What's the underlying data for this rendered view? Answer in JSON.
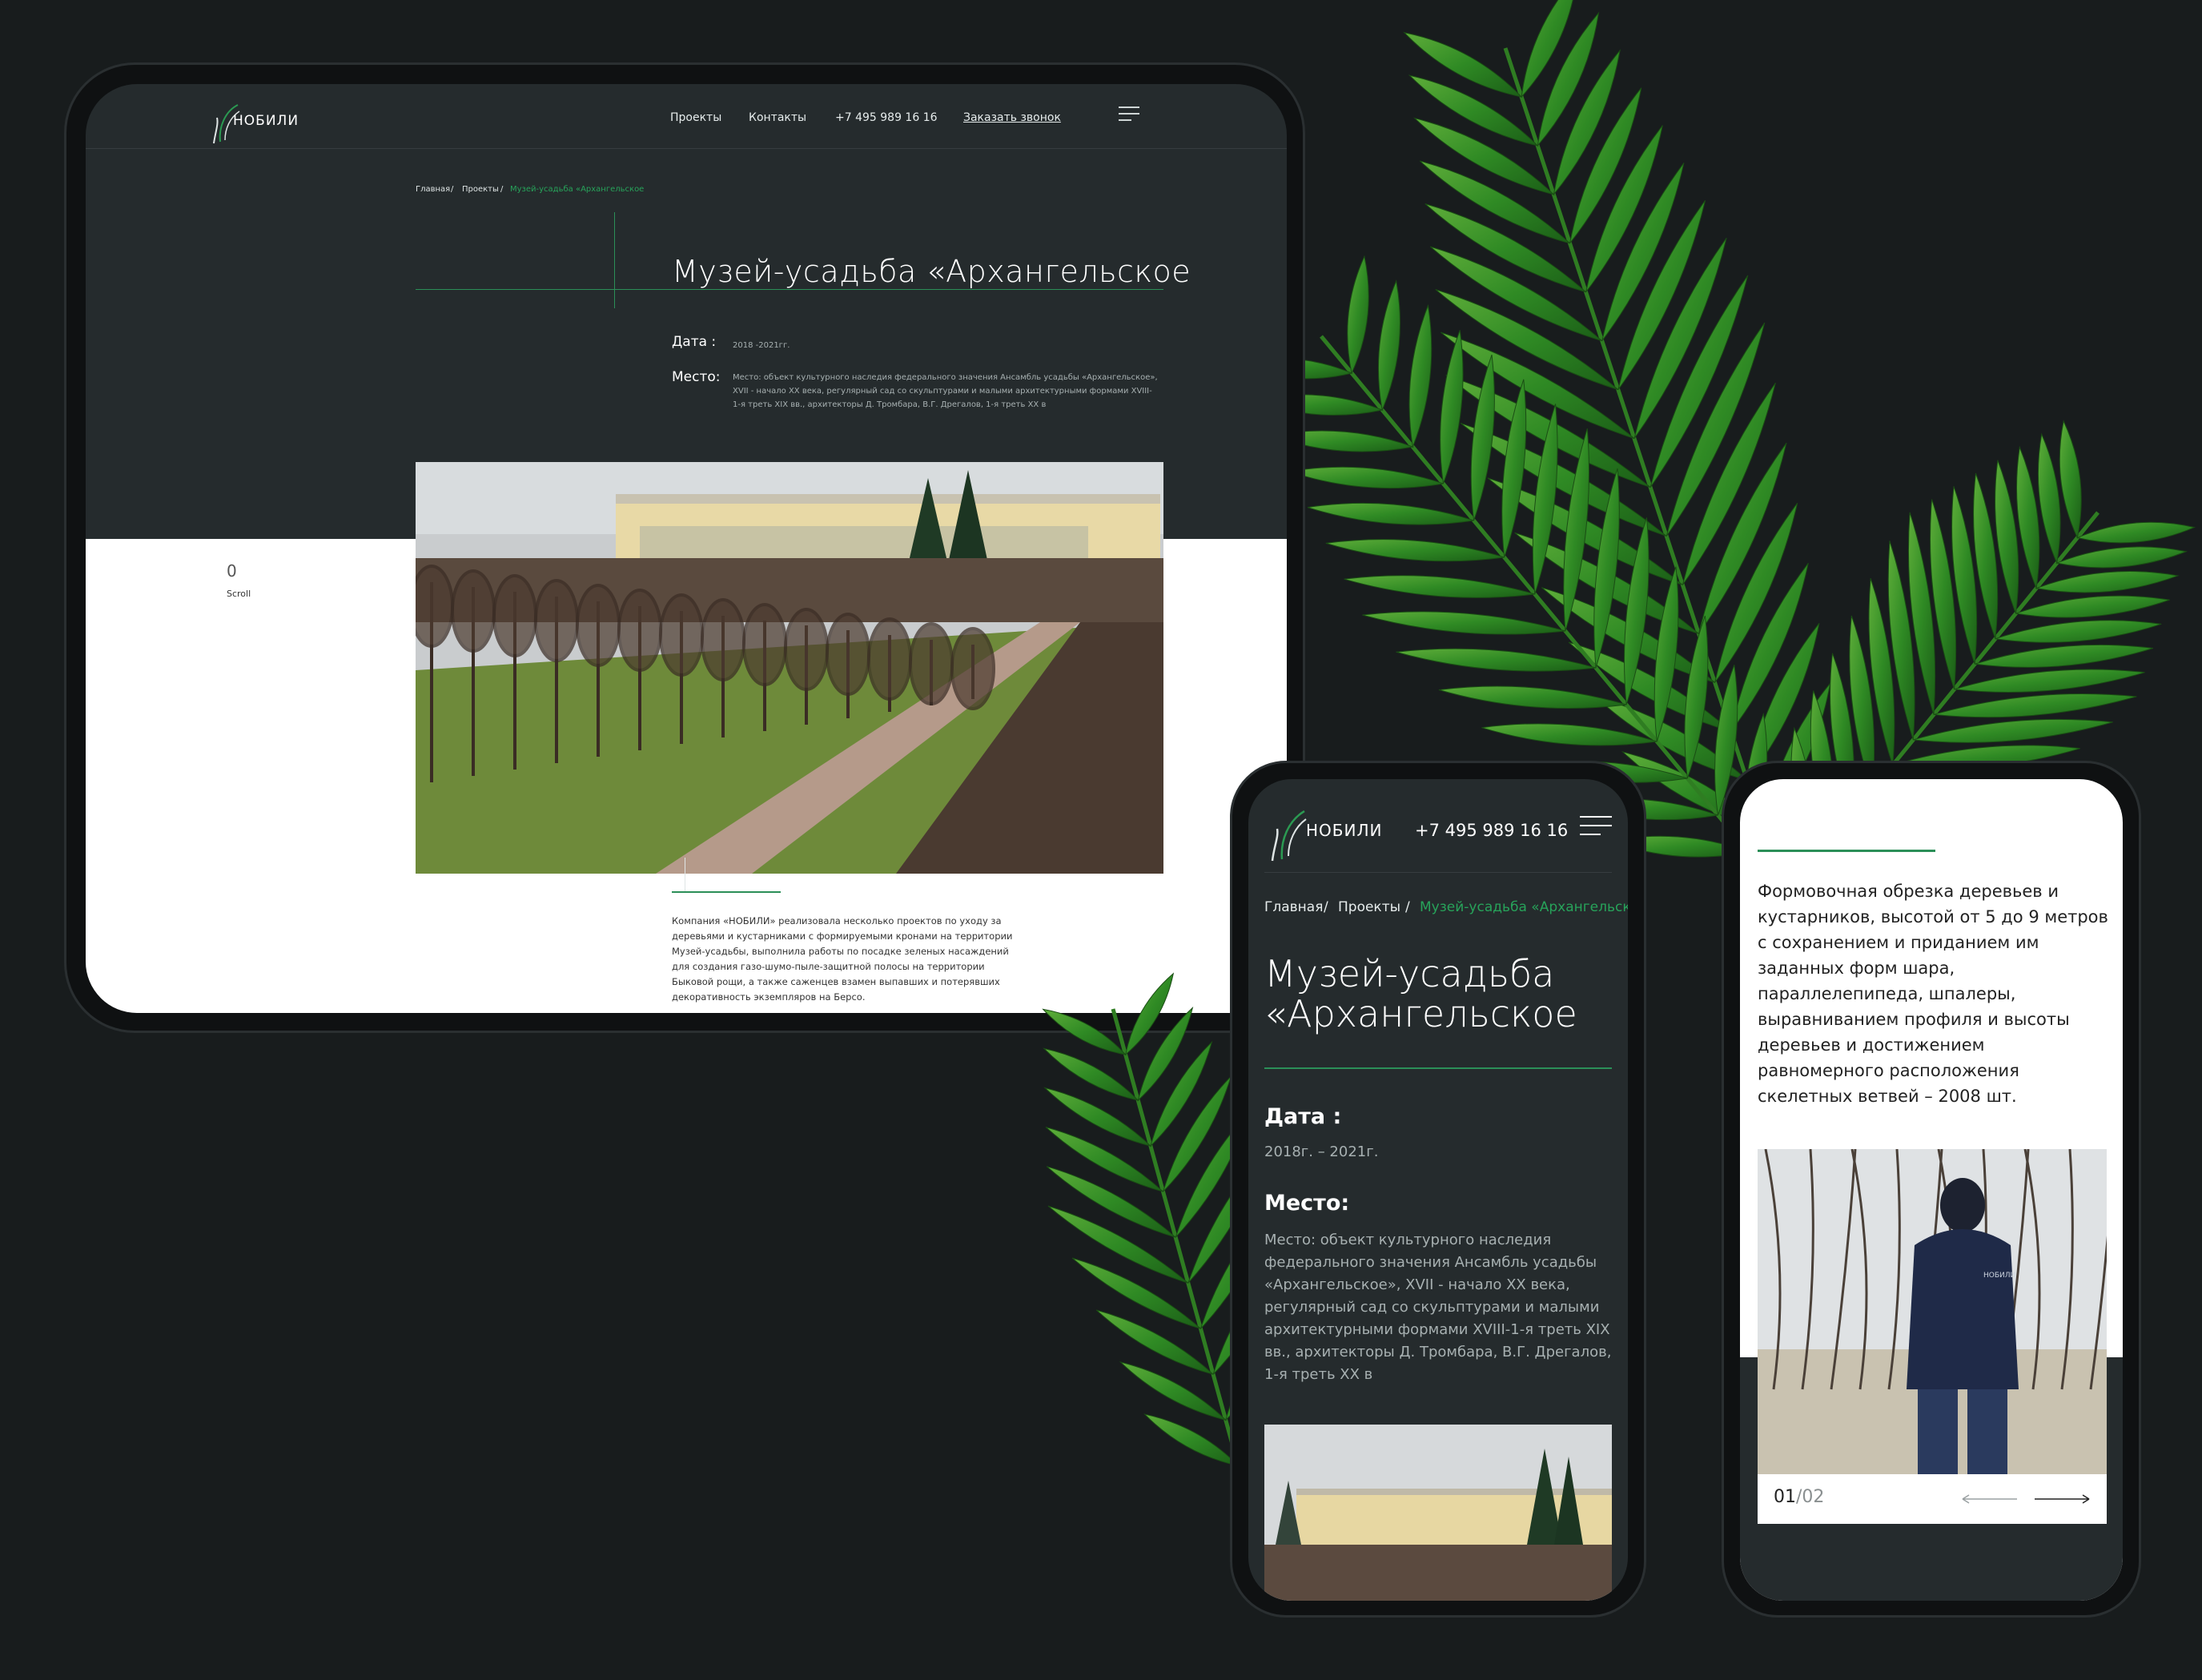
{
  "brand": {
    "logo_text": "НОБИЛИ"
  },
  "desktop": {
    "nav": {
      "projects": "Проекты",
      "contacts": "Контакты",
      "phone": "+7 495 989 16 16",
      "cta": "Заказать звонок"
    },
    "breadcrumb": {
      "home": "Главная",
      "sep1": "/",
      "projects": "Проекты",
      "sep2": "/",
      "current": "Музей-усадьба «Архангельское"
    },
    "title": "Музей-усадьба «Архангельское",
    "date_label": "Дата :",
    "date_value": "2018 -2021гг.",
    "place_label": "Место:",
    "place_value": "Место: объект культурного наследия федерального значения Ансамбль усадьбы «Архангельское», XVII - начало XX века, регулярный сад со скульптурами и малыми архитектурными формами XVIII-1-я треть XIX вв., архитекторы Д. Тромбара, В.Г. Дрегалов, 1-я треть XX в",
    "scroll_counter": "0",
    "scroll_label": "Scroll",
    "description": "Компания «НОБИЛИ» реализовала несколько проектов по уходу за деревьями и кустарниками с формируемыми кронами на территории Музей-усадьбы, выполнила работы по посадке зеленых насаждений для создания газо-шумо-пыле-защитной полосы на территории Быковой рощи, а также саженцев взамен выпавших и потерявших декоративность экземпляров на Берсо."
  },
  "mobile_left": {
    "phone": "+7 495 989 16 16",
    "breadcrumb": {
      "home": "Главная",
      "sep1": "/",
      "projects": "Проекты",
      "sep2": "/",
      "current": "Музей-усадьба «Архангельское"
    },
    "title_line1": "Музей-усадьба",
    "title_line2": "«Архангельское",
    "date_label": "Дата :",
    "date_value": "2018г. – 2021г.",
    "place_label": "Место:",
    "place_value": "Место: объект культурного наследия федерального значения Ансамбль усадьбы «Архангельское», XVII - начало XX века, регулярный сад со скульптурами и малыми архитектурными формами XVIII-1-я треть XIX вв., архитекторы Д. Тромбара, В.Г. Дрегалов, 1-я треть XX в"
  },
  "mobile_right": {
    "text": "Формовочная обрезка деревьев и кустарников, высотой от 5 до 9 метров с сохранением и приданием им заданных форм шара, параллелепипеда, шпалеры, выравниванием профиля и высоты деревьев и достижением равномерного расположения скелетных ветвей – 2008 шт.",
    "pager_current": "01",
    "pager_sep": "/",
    "pager_total": "02",
    "jacket_logo": "НОБИЛИ"
  },
  "colors": {
    "background": "#181c1d",
    "screen_dark": "#252b2d",
    "accent_green": "#27a35a",
    "white": "#ffffff"
  },
  "icons": [
    "logo-icon",
    "menu-icon",
    "arrow-left-icon",
    "arrow-right-icon",
    "palm-leaf-decoration"
  ]
}
